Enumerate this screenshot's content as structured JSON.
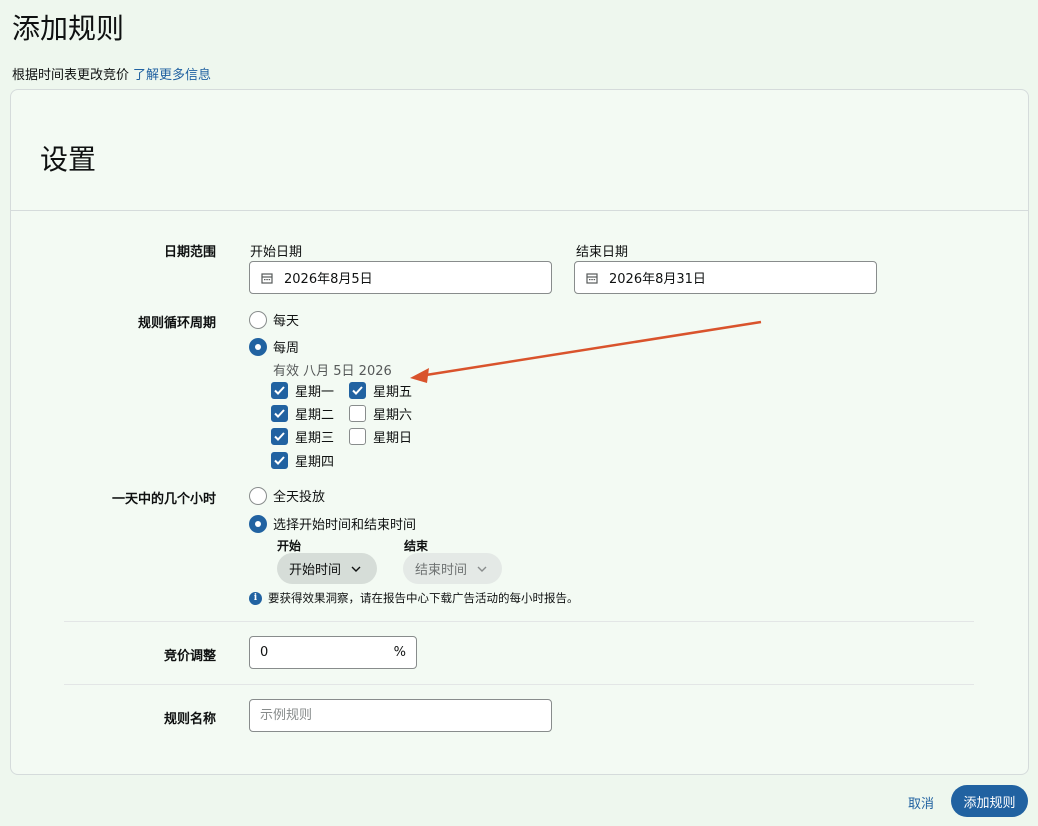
{
  "page": {
    "title": "添加规则",
    "subtitle": "根据时间表更改竞价",
    "learn_more": "了解更多信息"
  },
  "card": {
    "heading": "设置"
  },
  "date_range": {
    "label": "日期范围",
    "start_label": "开始日期",
    "start_value": "2026年8月5日",
    "end_label": "结束日期",
    "end_value": "2026年8月31日",
    "icon": "calendar-icon"
  },
  "recurrence": {
    "label": "规则循环周期",
    "options": [
      {
        "label": "每天",
        "selected": false
      },
      {
        "label": "每周",
        "selected": true
      }
    ],
    "effective": "有效 八月 5日 2026",
    "days": [
      {
        "label": "星期一",
        "checked": true
      },
      {
        "label": "星期二",
        "checked": true
      },
      {
        "label": "星期三",
        "checked": true
      },
      {
        "label": "星期四",
        "checked": true
      },
      {
        "label": "星期五",
        "checked": true
      },
      {
        "label": "星期六",
        "checked": false
      },
      {
        "label": "星期日",
        "checked": false
      }
    ]
  },
  "hours": {
    "label": "一天中的几个小时",
    "options": [
      {
        "label": "全天投放",
        "selected": false
      },
      {
        "label": "选择开始时间和结束时间",
        "selected": true
      }
    ],
    "start_label": "开始",
    "start_placeholder": "开始时间",
    "end_label": "结束",
    "end_placeholder": "结束时间",
    "note": "要获得效果洞察，请在报告中心下载广告活动的每小时报告。",
    "note_icon": "info-icon"
  },
  "bid_adjust": {
    "label": "竞价调整",
    "value": "0",
    "unit": "%"
  },
  "rule_name": {
    "label": "规则名称",
    "placeholder": "示例规则"
  },
  "footer": {
    "cancel": "取消",
    "submit": "添加规则"
  },
  "colors": {
    "accent": "#2162a1",
    "annotation_arrow": "#d9532c",
    "background": "#eef7ee"
  }
}
